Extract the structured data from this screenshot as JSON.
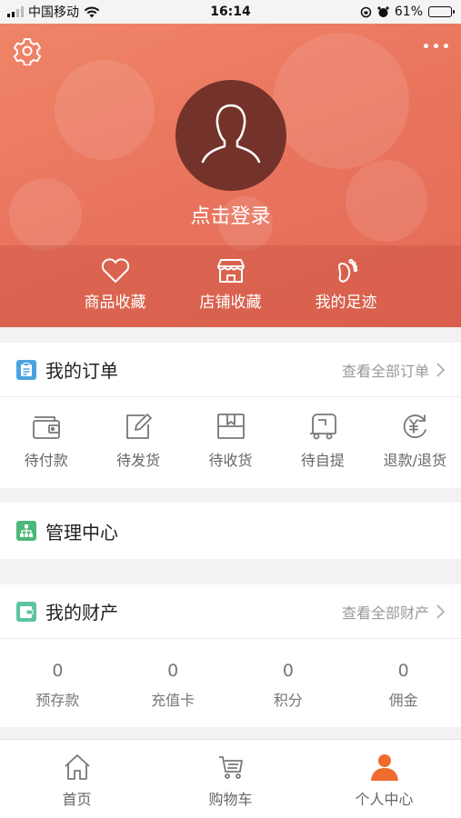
{
  "status_bar": {
    "carrier": "中国移动",
    "time": "16:14",
    "battery": "61%",
    "battery_level": 0.61
  },
  "header": {
    "login_text": "点击登录"
  },
  "quick_links": [
    {
      "label": "商品收藏",
      "icon": "heart-icon"
    },
    {
      "label": "店铺收藏",
      "icon": "store-icon"
    },
    {
      "label": "我的足迹",
      "icon": "footprint-icon"
    }
  ],
  "orders": {
    "title": "我的订单",
    "link": "查看全部订单",
    "items": [
      {
        "label": "待付款",
        "icon": "wallet-icon"
      },
      {
        "label": "待发货",
        "icon": "edit-icon"
      },
      {
        "label": "待收货",
        "icon": "package-icon"
      },
      {
        "label": "待自提",
        "icon": "truck-icon"
      },
      {
        "label": "退款/退货",
        "icon": "refund-icon"
      }
    ]
  },
  "management": {
    "title": "管理中心"
  },
  "assets": {
    "title": "我的财产",
    "link": "查看全部财产",
    "items": [
      {
        "value": "0",
        "label": "预存款"
      },
      {
        "value": "0",
        "label": "充值卡"
      },
      {
        "value": "0",
        "label": "积分"
      },
      {
        "value": "0",
        "label": "佣金"
      }
    ]
  },
  "tabbar": [
    {
      "label": "首页",
      "icon": "home-icon",
      "active": false
    },
    {
      "label": "购物车",
      "icon": "cart-icon",
      "active": false
    },
    {
      "label": "个人中心",
      "icon": "person-icon",
      "active": true
    }
  ],
  "colors": {
    "header": "#e9745d",
    "accent": "#ef6b2e",
    "orders_icon": "#4aa3df",
    "management_icon": "#4cb87a",
    "assets_icon": "#5cc4a0"
  }
}
